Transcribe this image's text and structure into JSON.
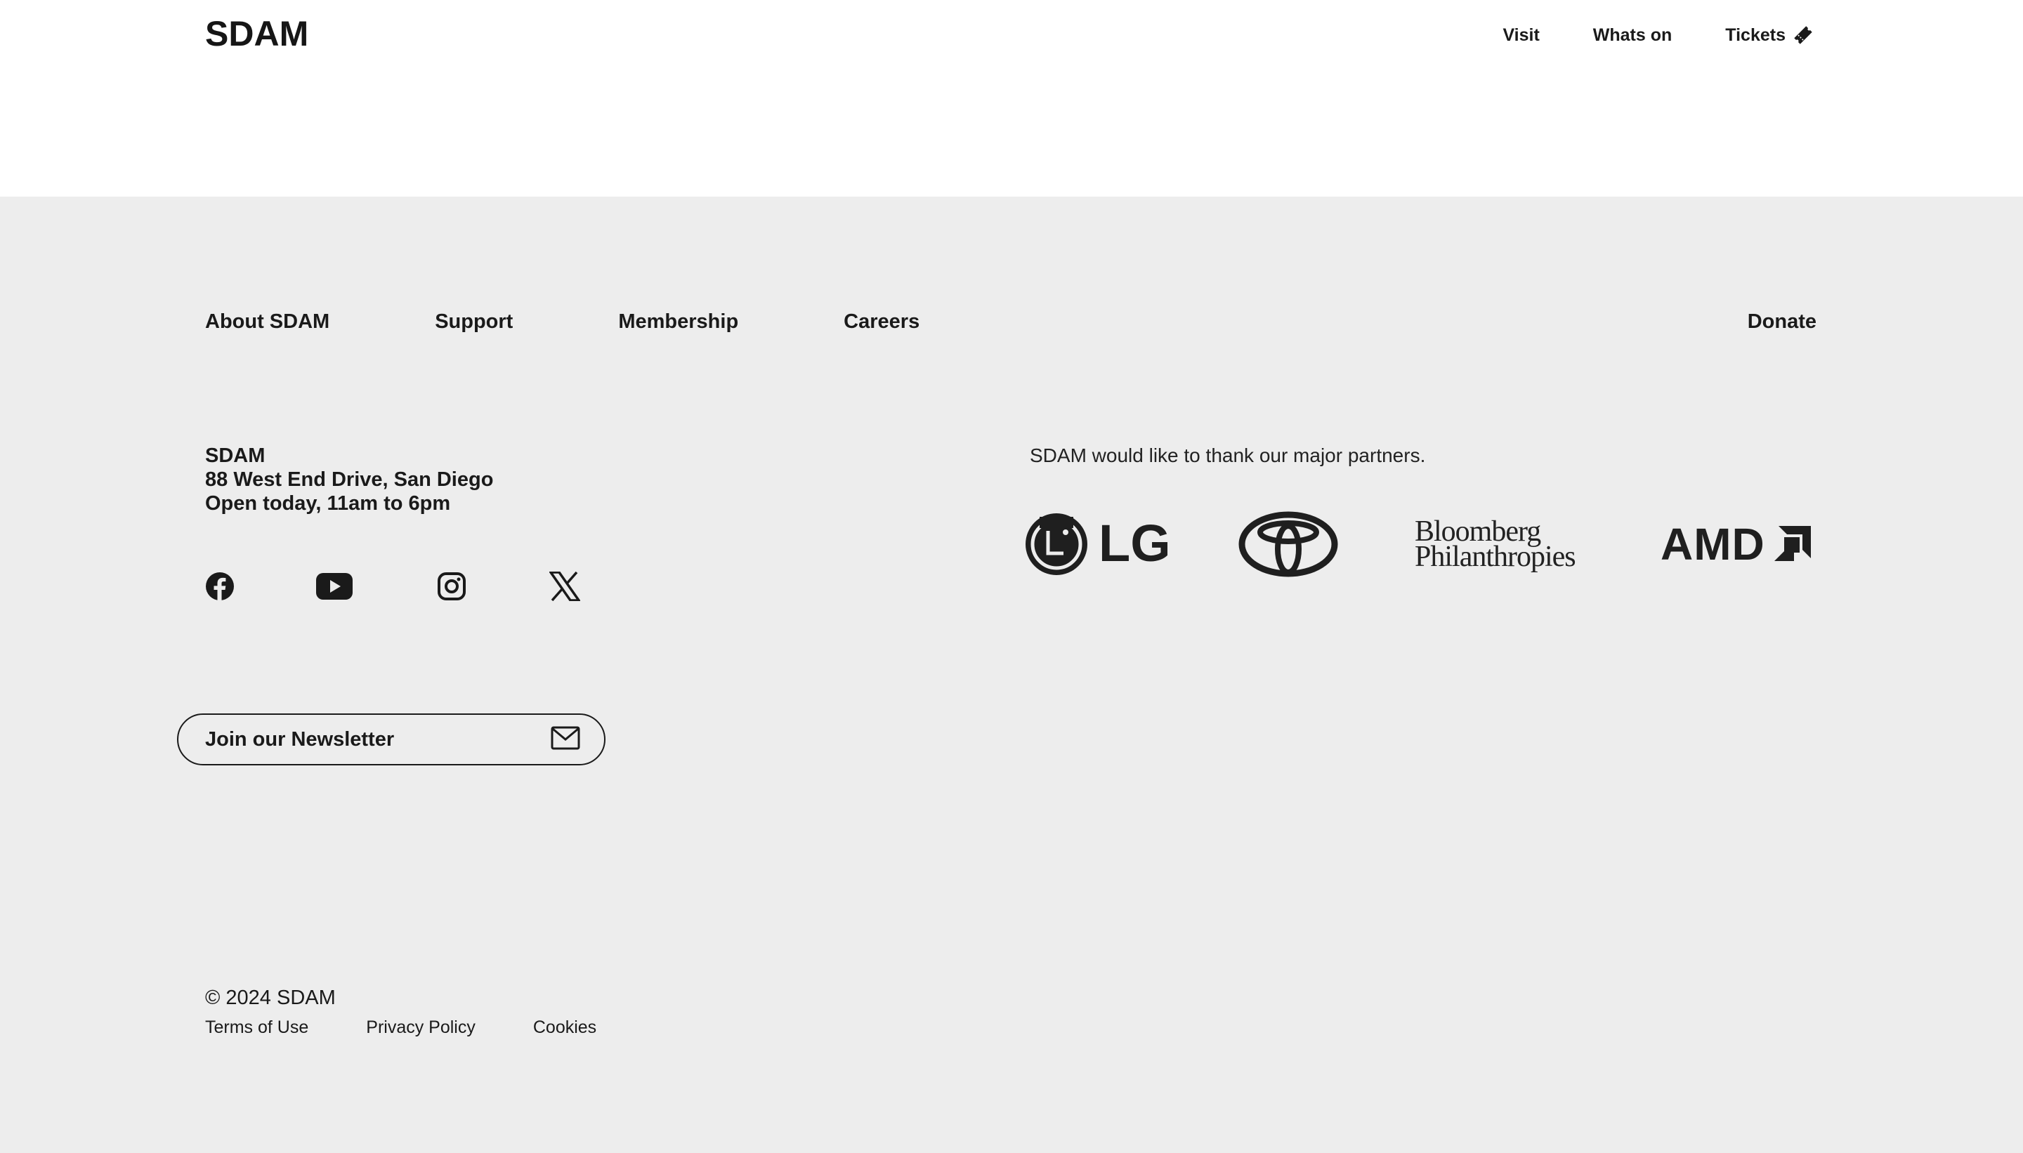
{
  "header": {
    "logo": "SDAM",
    "nav": {
      "visit": "Visit",
      "whats_on": "Whats on",
      "tickets": "Tickets"
    }
  },
  "footer": {
    "nav": {
      "about": "About SDAM",
      "support": "Support",
      "membership": "Membership",
      "careers": "Careers",
      "donate": "Donate"
    },
    "address": {
      "name": "SDAM",
      "street": "88 West End Drive, San Diego",
      "hours": "Open today, 11am to 6pm"
    },
    "socials": [
      "facebook-icon",
      "youtube-icon",
      "instagram-icon",
      "x-icon"
    ],
    "newsletter": {
      "label": "Join our Newsletter",
      "icon": "mail-icon"
    },
    "partners": {
      "intro": "SDAM would like to thank our major partners.",
      "logos": {
        "lg": "LG",
        "toyota": "toyota-logo",
        "bloomberg_line1": "Bloomberg",
        "bloomberg_line2": "Philanthropies",
        "amd": "AMD"
      }
    },
    "copyright": "© 2024 SDAM",
    "legal": {
      "terms": "Terms of Use",
      "privacy": "Privacy Policy",
      "cookies": "Cookies"
    }
  },
  "colors": {
    "text": "#1a1a1a",
    "footer_bg": "#ededed",
    "header_bg": "#ffffff"
  }
}
